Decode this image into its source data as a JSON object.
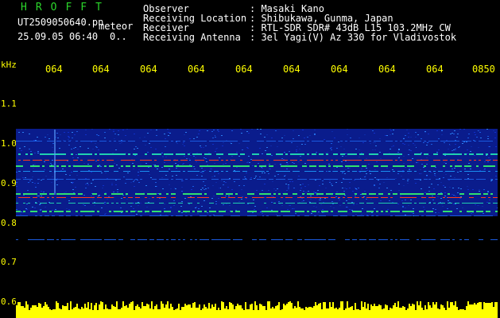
{
  "header": {
    "title": "HROFFT",
    "filename": "UT2509050640.pn",
    "meteor_tag": "meteor",
    "datetime": "25.09.05 06:40",
    "counter": "0..",
    "fields": [
      {
        "label": "Observer",
        "value": ": Masaki Kano"
      },
      {
        "label": "Receiving Location",
        "value": ": Shibukawa, Gunma, Japan"
      },
      {
        "label": "Receiver",
        "value": ": RTL-SDR SDR# 43dB L15 103.2MHz CW"
      },
      {
        "label": "Receiving Antenna",
        "value": ": 3el Yagi(V) Az 330 for Vladivostok"
      }
    ]
  },
  "axis": {
    "unit": "kHz",
    "y_ticks": [
      "1.1",
      "1.0",
      "0.9",
      "0.8",
      "0.7",
      "0.6"
    ],
    "x_ticks": [
      "064",
      "064",
      "064",
      "064",
      "064",
      "064",
      "064",
      "064",
      "064",
      "0850"
    ]
  },
  "colors": {
    "background": "#000000",
    "text_labels": "#ffffff",
    "text_title": "#2bd62b",
    "axis_text": "#ffff00",
    "noise_floor": "#0a1c8c",
    "signal_red": "#ff3a1a",
    "audio_level": "#ffff00"
  }
}
